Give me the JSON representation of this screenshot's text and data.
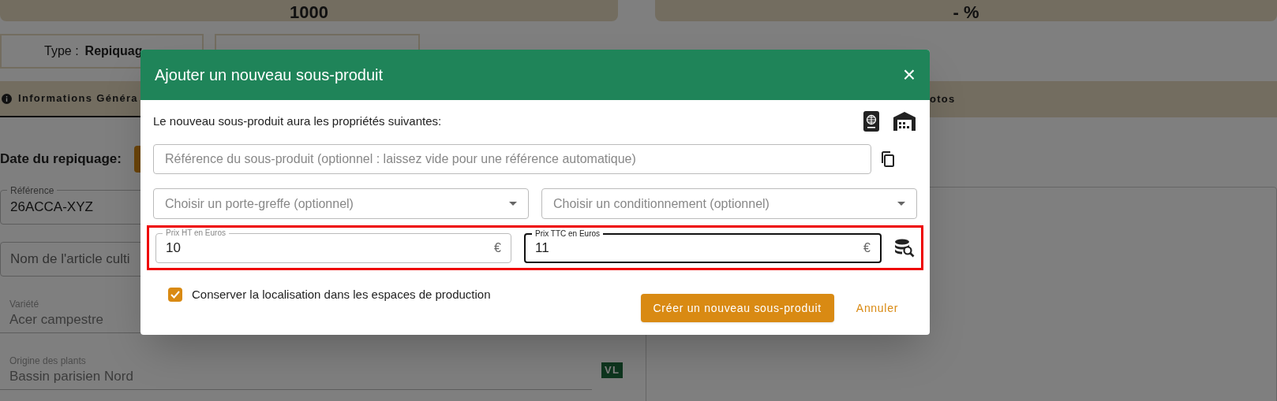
{
  "background": {
    "stats": [
      "1000",
      "- %"
    ],
    "type": {
      "label": "Type :",
      "value": "Repiquag"
    },
    "tabs": [
      {
        "label": "Informations Généra",
        "selected": true
      },
      {
        "label": "otos",
        "selected": false
      }
    ],
    "date_label": "Date du repiquage:",
    "fields": [
      {
        "kind": "outlined",
        "label": "Référence",
        "value": "26ACCA-XYZ"
      },
      {
        "kind": "outlined",
        "placeholder": "Nom de l'article culti"
      },
      {
        "kind": "underline",
        "label": "Variété",
        "value": "Acer campestre"
      },
      {
        "kind": "underline",
        "label": "Origine des plants",
        "value": "Bassin parisien Nord",
        "badge": "VL"
      }
    ]
  },
  "dialog": {
    "title": "Ajouter un nouveau sous-produit",
    "close": "×",
    "intro": "Le nouveau sous-produit aura les propriétés suivantes:",
    "reference": {
      "placeholder": "Référence du sous-produit (optionnel : laissez vide pour une référence automatique)"
    },
    "selects": [
      {
        "placeholder": "Choisir un porte-greffe (optionnel)"
      },
      {
        "placeholder": "Choisir un conditionnement (optionnel)"
      }
    ],
    "prices": [
      {
        "label": "Prix HT en Euros",
        "value": "10",
        "unit": "€",
        "focused": false
      },
      {
        "label": "Prix TTC en Euros",
        "value": "11",
        "unit": "€",
        "focused": true
      }
    ],
    "keep_location": {
      "label": "Conserver la localisation dans les espaces de production",
      "checked": true
    },
    "buttons": [
      {
        "kind": "primary",
        "label": "Créer un nouveau sous-produit"
      },
      {
        "kind": "text",
        "label": "Annuler"
      }
    ]
  }
}
